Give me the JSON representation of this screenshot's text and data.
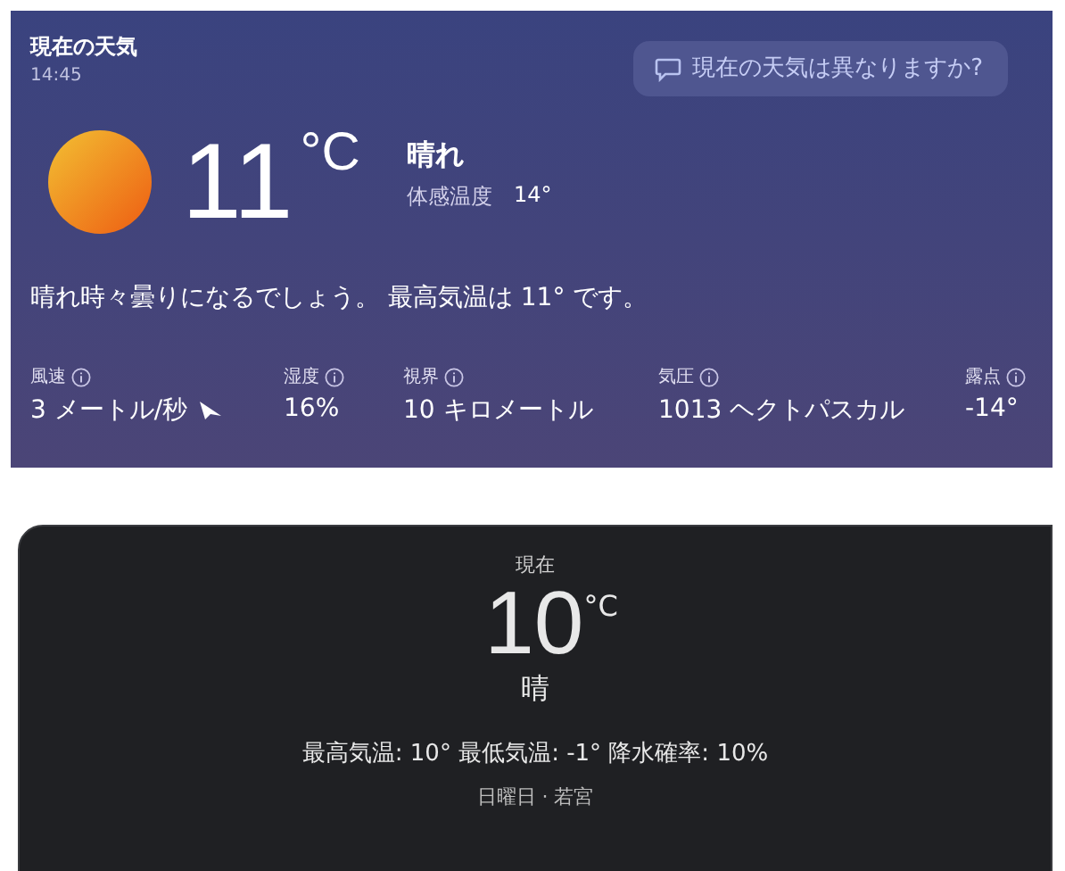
{
  "current": {
    "title": "現在の天気",
    "time": "14:45",
    "feedback_button": "現在の天気は異なりますか?",
    "temperature": "11",
    "unit": "°C",
    "condition": "晴れ",
    "feels_like_label": "体感温度",
    "feels_like": "14°",
    "summary": "晴れ時々曇りになるでしょう。 最高気温は 11° です。",
    "stats": [
      {
        "label": "風速",
        "value": "3 メートル/秒",
        "kind": "wind"
      },
      {
        "label": "湿度",
        "value": "16%",
        "kind": "plain"
      },
      {
        "label": "視界",
        "value": "10 キロメートル",
        "kind": "plain"
      },
      {
        "label": "気圧",
        "value": "1013 ヘクトパスカル",
        "kind": "plain"
      },
      {
        "label": "露点",
        "value": "-14°",
        "kind": "plain"
      }
    ]
  },
  "now": {
    "label": "現在",
    "temperature": "10",
    "unit": "°C",
    "condition": "晴",
    "details": "最高気温: 10° 最低気温: -1° 降水確率: 10%",
    "location": "日曜日 · 若宮"
  }
}
